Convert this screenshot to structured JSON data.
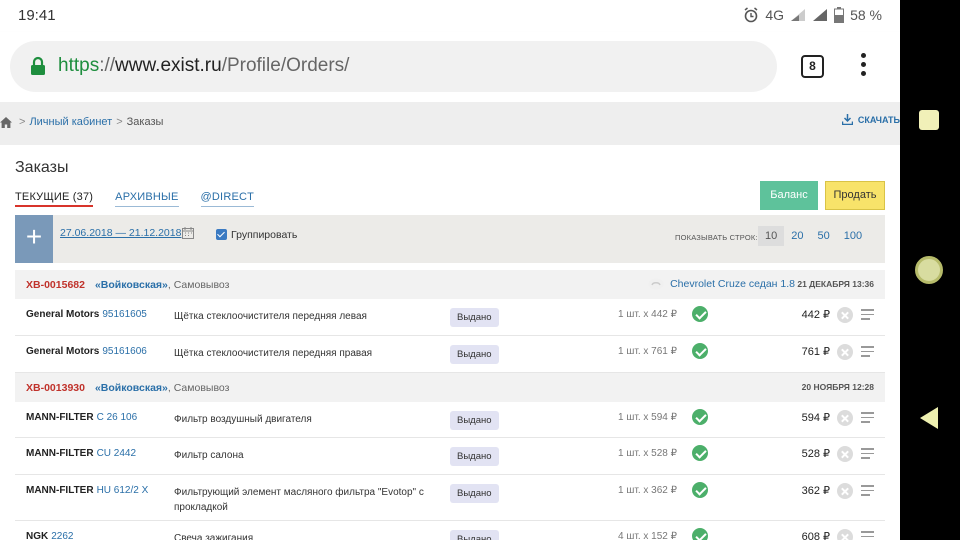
{
  "status_bar": {
    "time": "19:41",
    "network": "4G",
    "battery": "58 %"
  },
  "browser": {
    "url_scheme": "https",
    "url_sep": "://",
    "url_host": "www.exist.ru",
    "url_path": "/Profile/Orders/",
    "tab_count": "8"
  },
  "breadcrumb": {
    "cabinet": "Личный кабинет",
    "current": "Заказы"
  },
  "download_label": "СКАЧАТЬ",
  "page": {
    "title": "Заказы",
    "tabs": [
      {
        "label": "ТЕКУЩИЕ (37)",
        "active": true
      },
      {
        "label": "АРХИВНЫЕ",
        "active": false
      },
      {
        "label": "@DIRECT",
        "active": false
      }
    ],
    "btn_balance": "Баланс",
    "btn_sell": "Продать"
  },
  "filters": {
    "add": "+",
    "date_range": "27.06.2018 — 21.12.2018",
    "group_label": "Группировать",
    "group_checked": true,
    "rows_label": "ПОКАЗЫВАТЬ СТРОК:",
    "rows_options": [
      "10",
      "20",
      "50",
      "100"
    ],
    "rows_selected": "10"
  },
  "orders": [
    {
      "number": "ХВ-0015682",
      "place": "«Войковская»",
      "delivery": ", Самовывоз",
      "car": "Chevrolet Cruze седан 1.8",
      "date": "21 ДЕКАБРЯ 13:36",
      "items": [
        {
          "brand": "General Motors",
          "code": "95161605",
          "desc": "Щётка стеклоочистителя передняя левая",
          "status": "Выдано",
          "qty": "1 шт. x 442 ₽",
          "sum": "442 ₽"
        },
        {
          "brand": "General Motors",
          "code": "95161606",
          "desc": "Щётка стеклоочистителя передняя правая",
          "status": "Выдано",
          "qty": "1 шт. x 761 ₽",
          "sum": "761 ₽"
        }
      ]
    },
    {
      "number": "ХВ-0013930",
      "place": "«Войковская»",
      "delivery": ", Самовывоз",
      "car": "",
      "date": "20 НОЯБРЯ 12:28",
      "items": [
        {
          "brand": "MANN-FILTER",
          "code": "C 26 106",
          "desc": "Фильтр воздушный двигателя",
          "status": "Выдано",
          "qty": "1 шт. x 594 ₽",
          "sum": "594 ₽"
        },
        {
          "brand": "MANN-FILTER",
          "code": "CU 2442",
          "desc": "Фильтр салона",
          "status": "Выдано",
          "qty": "1 шт. x 528 ₽",
          "sum": "528 ₽"
        },
        {
          "brand": "MANN-FILTER",
          "code": "HU 612/2 X",
          "desc": "Фильтрующий элемент масляного фильтра \"Evotop\" с прокладкой",
          "status": "Выдано",
          "qty": "1 шт. x 362 ₽",
          "sum": "362 ₽"
        },
        {
          "brand": "NGK",
          "code": "2262",
          "desc": "Свеча зажигания",
          "status": "Выдано",
          "qty": "4 шт. x 152 ₽",
          "sum": "608 ₽"
        }
      ]
    }
  ]
}
